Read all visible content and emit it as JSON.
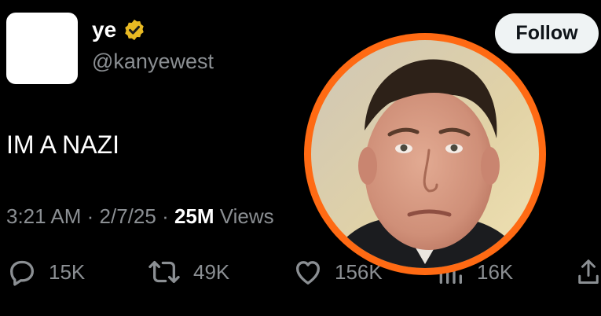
{
  "author": {
    "display_name": "ye",
    "handle": "@kanyewest"
  },
  "follow_label": "Follow",
  "tweet": {
    "text": "IM A NAZI",
    "time": "3:21 AM",
    "date": "2/7/25",
    "views_count": "25M",
    "views_label": "Views"
  },
  "actions": {
    "replies": "15K",
    "reposts": "49K",
    "likes": "156K",
    "bookmarks": "16K"
  },
  "icons": {
    "verified": "verified-badge-icon",
    "reply": "reply-bubble-icon",
    "repost": "repost-arrows-icon",
    "like": "heart-icon",
    "views": "views-bars-icon",
    "share": "share-upload-icon"
  },
  "colors": {
    "background": "#000000",
    "verified_gold": "#e8b923",
    "photo_ring": "#ff6a13",
    "muted_text": "#8b8f93",
    "follow_bg": "#eff3f4"
  }
}
